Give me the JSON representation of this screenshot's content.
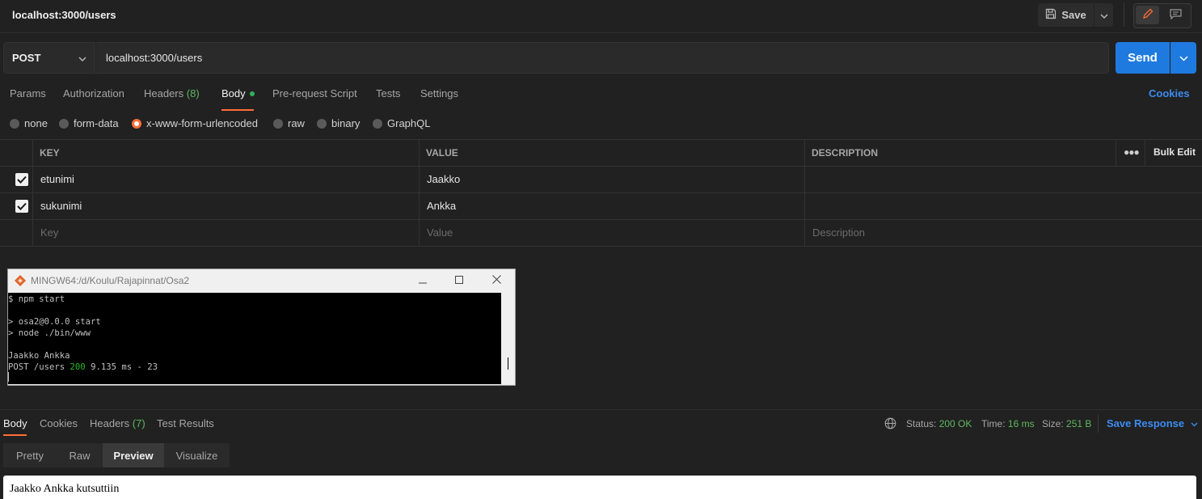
{
  "request": {
    "title": "localhost:3000/users",
    "save_label": "Save",
    "method": "POST",
    "url": "localhost:3000/users",
    "send_label": "Send"
  },
  "tabs": {
    "params": "Params",
    "authorization": "Authorization",
    "headers": "Headers",
    "headers_count": "(8)",
    "body": "Body",
    "prerequest": "Pre-request Script",
    "tests": "Tests",
    "settings": "Settings",
    "cookies": "Cookies"
  },
  "body_types": {
    "none": "none",
    "form_data": "form-data",
    "urlencoded": "x-www-form-urlencoded",
    "raw": "raw",
    "binary": "binary",
    "graphql": "GraphQL",
    "selected": "x-www-form-urlencoded"
  },
  "table": {
    "headers": {
      "key": "KEY",
      "value": "VALUE",
      "description": "DESCRIPTION",
      "bulk_edit": "Bulk Edit"
    },
    "rows": [
      {
        "key": "etunimi",
        "value": "Jaakko",
        "checked": true
      },
      {
        "key": "sukunimi",
        "value": "Ankka",
        "checked": true
      }
    ],
    "placeholders": {
      "key": "Key",
      "value": "Value",
      "description": "Description"
    }
  },
  "terminal": {
    "title": "MINGW64:/d/Koulu/Rajapinnat/Osa2",
    "line1": "$ npm start",
    "line2": "> osa2@0.0.0 start",
    "line3": "> node ./bin/www",
    "line4": "Jaakko Ankka",
    "line5_prefix": "POST /users ",
    "line5_status": "200",
    "line5_suffix": " 9.135 ms - 23"
  },
  "response": {
    "tabs": {
      "body": "Body",
      "cookies": "Cookies",
      "headers": "Headers",
      "headers_count": "(7)",
      "test_results": "Test Results"
    },
    "status_label": "Status:",
    "status_value": "200 OK",
    "time_label": "Time:",
    "time_value": "16 ms",
    "size_label": "Size:",
    "size_value": "251 B",
    "save_response": "Save Response",
    "views": {
      "pretty": "Pretty",
      "raw": "Raw",
      "preview": "Preview",
      "visualize": "Visualize"
    },
    "active_view": "Preview",
    "preview_text": "Jaakko Ankka kutsuttiin"
  },
  "colors": {
    "accent": "#ff6c37",
    "send": "#1f7ae0",
    "success": "#5fb85f",
    "link": "#3d8bf0"
  }
}
